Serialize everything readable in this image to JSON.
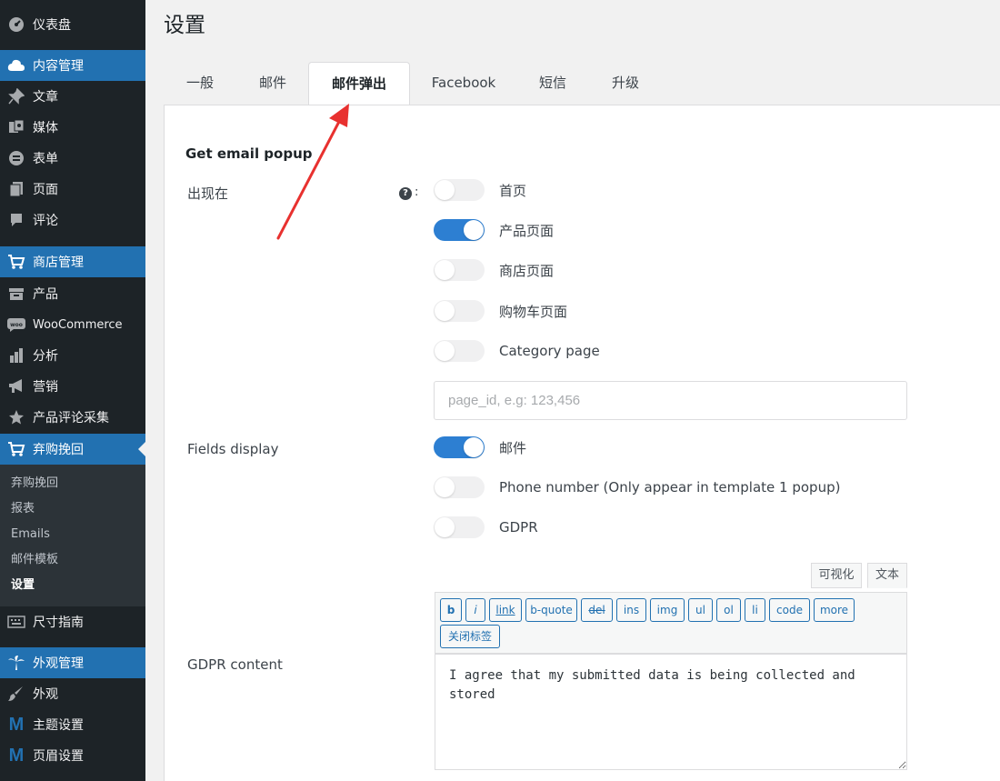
{
  "sidebar": {
    "items": [
      {
        "label": "仪表盘",
        "icon": "dashboard-icon"
      },
      {
        "label": "内容管理",
        "icon": "cloud-icon"
      },
      {
        "label": "文章",
        "icon": "pin-icon"
      },
      {
        "label": "媒体",
        "icon": "media-icon"
      },
      {
        "label": "表单",
        "icon": "form-icon"
      },
      {
        "label": "页面",
        "icon": "page-icon"
      },
      {
        "label": "评论",
        "icon": "comment-icon"
      },
      {
        "label": "商店管理",
        "icon": "cart-icon"
      },
      {
        "label": "产品",
        "icon": "archive-icon"
      },
      {
        "label": "WooCommerce",
        "icon": "woo-icon"
      },
      {
        "label": "分析",
        "icon": "chart-bar-icon"
      },
      {
        "label": "营销",
        "icon": "megaphone-icon"
      },
      {
        "label": "产品评论采集",
        "icon": "star-icon"
      },
      {
        "label": "弃购挽回",
        "icon": "cart-icon"
      },
      {
        "label": "尺寸指南",
        "icon": "keyboard-icon"
      },
      {
        "label": "外观管理",
        "icon": "palm-icon"
      },
      {
        "label": "外观",
        "icon": "brush-icon"
      },
      {
        "label": "主题设置",
        "icon": "m-logo-icon"
      },
      {
        "label": "页眉设置",
        "icon": "m-logo-icon"
      }
    ],
    "submenu": [
      "弃购挽回",
      "报表",
      "Emails",
      "邮件模板",
      "设置"
    ]
  },
  "page": {
    "title": "设置",
    "tabs": [
      "一般",
      "邮件",
      "邮件弹出",
      "Facebook",
      "短信",
      "升级"
    ],
    "active_tab": "邮件弹出"
  },
  "form": {
    "section_title": "Get email popup",
    "appear_label": "出现在",
    "help_glyph": "?",
    "help_colon": ":",
    "appear_options": [
      {
        "label": "首页",
        "on": false
      },
      {
        "label": "产品页面",
        "on": true
      },
      {
        "label": "商店页面",
        "on": false
      },
      {
        "label": "购物车页面",
        "on": false
      },
      {
        "label": "Category page",
        "on": false
      }
    ],
    "page_id_placeholder": "page_id, e.g: 123,456",
    "fields_label": "Fields display",
    "fields_options": [
      {
        "label": "邮件",
        "on": true
      },
      {
        "label": "Phone number (Only appear in template 1 popup)",
        "on": false
      },
      {
        "label": "GDPR",
        "on": false
      }
    ],
    "gdpr_label": "GDPR content",
    "editor_tabs": [
      "可视化",
      "文本"
    ],
    "quicktags": [
      "b",
      "i",
      "link",
      "b-quote",
      "del",
      "ins",
      "img",
      "ul",
      "ol",
      "li",
      "code",
      "more",
      "关闭标签"
    ],
    "gdpr_content": "I agree that my submitted data is being collected and stored"
  },
  "colors": {
    "sidebar_bg": "#1d2327",
    "accent": "#2271b1",
    "toggle_on": "#2d7fd2",
    "annotation_arrow": "#e8312f"
  }
}
